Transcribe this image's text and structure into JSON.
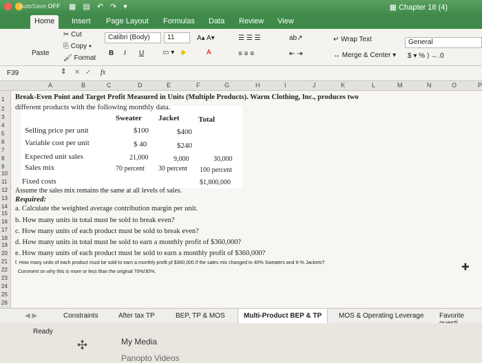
{
  "app": {
    "autosave": "AutoSave",
    "autosave_state": "OFF",
    "doc_title": "Chapter 18 (4)"
  },
  "ribbon_tabs": [
    "Home",
    "Insert",
    "Page Layout",
    "Formulas",
    "Data",
    "Review",
    "View"
  ],
  "ribbon": {
    "cut": "Cut",
    "copy": "Copy",
    "format": "Format",
    "paste": "Paste",
    "font_name": "Calibri (Body)",
    "font_size": "11",
    "wrap_text": "Wrap Text",
    "merge_center": "Merge & Center",
    "number_format": "General",
    "currency": "$",
    "percent": "%"
  },
  "formula_bar": {
    "name_box": "F39",
    "fx": "fx",
    "value": ""
  },
  "columns": [
    "A",
    "B",
    "C",
    "D",
    "E",
    "F",
    "G",
    "H",
    "I",
    "J",
    "K",
    "L",
    "M",
    "N",
    "O",
    "P"
  ],
  "rows": [
    "1",
    "2",
    "3",
    "4",
    "5",
    "6",
    "7",
    "8",
    "9",
    "10",
    "11",
    "12",
    "13",
    "14",
    "15",
    "16",
    "17",
    "18",
    "19",
    "20",
    "21",
    "22",
    "23",
    "24",
    "25",
    "26"
  ],
  "sheet": {
    "title1": "Break-Even Point and Target Profit Measured in Units (Multiple Products). Warm Clothing, Inc., produces two",
    "title2": "different products with the following monthly data.",
    "h_sweater": "Sweater",
    "h_jacket": "Jacket",
    "h_total": "Total",
    "r5_label": "Selling price per unit",
    "r5_s": "$100",
    "r5_j": "$400",
    "r6_label": "Variable cost per unit",
    "r6_s": "$ 40",
    "r6_j": "$240",
    "r8_label": "Expected unit sales",
    "r8_s": "21,000",
    "r8_j": "9,000",
    "r8_t": "30,000",
    "r9_label": "Sales mix",
    "r9_s": "70 percent",
    "r9_j": "30 percent",
    "r9_t": "100 percent",
    "r11_label": "Fixed costs",
    "r11_t": "$1,800,000",
    "r12": "Assume the sales mix remains the same at all levels of sales.",
    "r13": "Required:",
    "q_a": "a.  Calculate the weighted average contribution margin per unit.",
    "q_b": "b.  How many units in total must be sold to break even?",
    "q_c": "c.  How many units of each product must be sold to break even?",
    "q_d": "d.  How many units in total must be sold to earn a monthly profit of $360,000?",
    "q_e": "e.  How many units of each product must be sold to earn a monthly profit of $360,000?",
    "q_f": "f. How many units of each product must be sold to earn a monthly profit pf $360,000 if the sales mix changed to 40% Sweaters and 6-% Jackets?",
    "q_g": "Comment on why this is more or less than the original 70%/30%."
  },
  "sheet_tabs": [
    "Constraints",
    "After tax TP",
    "BEP, TP & MOS",
    "Multi-Product BEP & TP",
    "MOS & Operating Leverage",
    "Favorite questi"
  ],
  "status": {
    "ready": "Ready"
  },
  "dock": {
    "item1": "My Media",
    "item2": "Panopto Videos"
  }
}
